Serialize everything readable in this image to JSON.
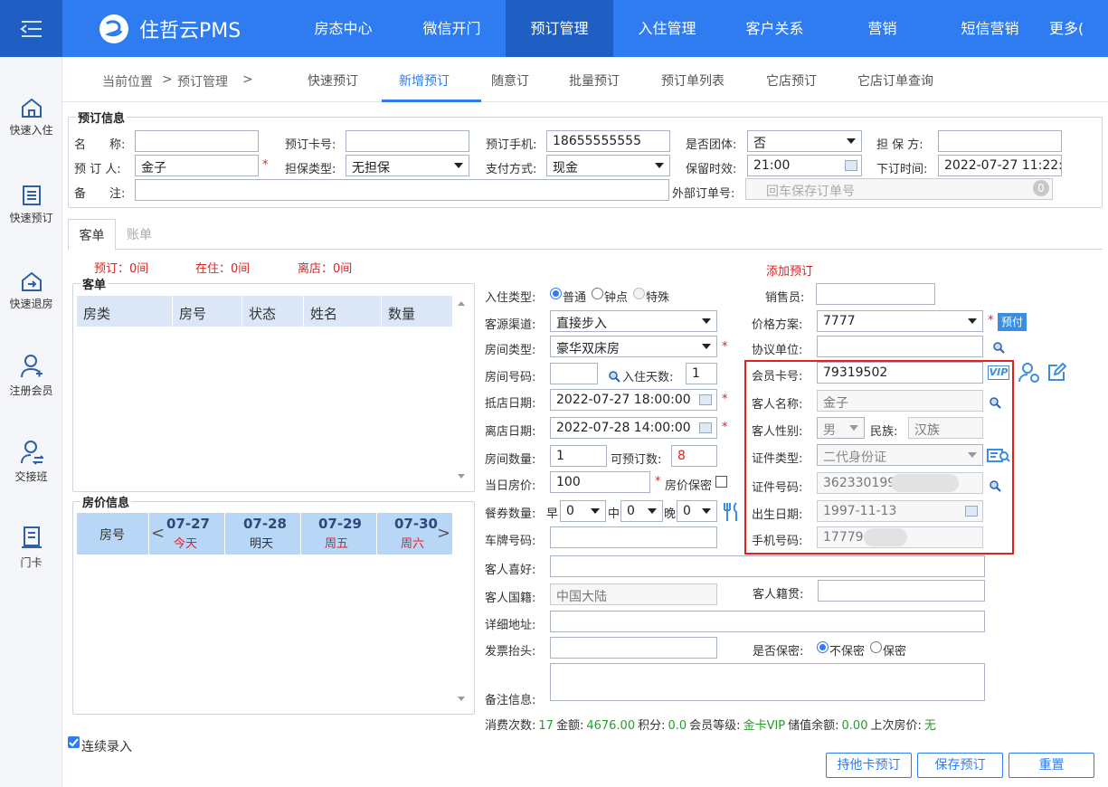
{
  "app": {
    "name": "住哲云PMS"
  },
  "nav": [
    "房态中心",
    "微信开门",
    "预订管理",
    "入住管理",
    "客户关系",
    "营销",
    "短信营销",
    "更多("
  ],
  "sidebar": [
    "快速入住",
    "快速预订",
    "快速退房",
    "注册会员",
    "交接班",
    "门卡"
  ],
  "breadcrumb": {
    "label": "当前位置",
    "sep1": ">",
    "page": "预订管理",
    "sep2": ">"
  },
  "subtabs": [
    "快速预订",
    "新增预订",
    "随意订",
    "批量预订",
    "预订单列表",
    "它店预订",
    "它店订单查询"
  ],
  "booking": {
    "legend": "预订信息",
    "name_label": "名　　称:",
    "name_value": "",
    "booker_label": "预 订 人:",
    "booker_value": "金子",
    "remark_label": "备　　注:",
    "remark_value": "",
    "card_label": "预订卡号:",
    "card_value": "",
    "guarantee_type_label": "担保类型:",
    "guarantee_type_value": "无担保",
    "phone_label": "预订手机:",
    "phone_value": "18655555555",
    "pay_label": "支付方式:",
    "pay_value": "现金",
    "group_label": "是否团体:",
    "group_value": "否",
    "hold_label": "保留时效:",
    "hold_value": "21:00",
    "guarantor_label": "担 保 方:",
    "guarantor_value": "",
    "order_time_label": "下订时间:",
    "order_time_value": "2022-07-27 11:22:5",
    "ext_order_label": "外部订单号:",
    "ext_order_placeholder": "回车保存订单号",
    "ext_badge": "0"
  },
  "tabs": {
    "guest": "客单",
    "bill": "账单"
  },
  "stats": {
    "reserved": "预订：0间",
    "in": "在住：0间",
    "out": "离店：0间"
  },
  "add_link": "添加预订",
  "guest_list": {
    "legend": "客单",
    "cols": [
      "房类",
      "房号",
      "状态",
      "姓名",
      "数量"
    ]
  },
  "price": {
    "legend": "房价信息",
    "room_no": "房号",
    "days": [
      {
        "date": "07-27",
        "sub": "今天"
      },
      {
        "date": "07-28",
        "sub": "明天"
      },
      {
        "date": "07-29",
        "sub": "周五"
      },
      {
        "date": "07-30",
        "sub": "周六"
      }
    ]
  },
  "form": {
    "checkin_type_label": "入住类型:",
    "checkin_types": [
      "普通",
      "钟点",
      "特殊"
    ],
    "source_label": "客源渠道:",
    "source_value": "直接步入",
    "room_type_label": "房间类型:",
    "room_type_value": "豪华双床房",
    "room_no_label": "房间号码:",
    "room_no_value": "",
    "days_label": "入住天数:",
    "days_value": "1",
    "arrive_label": "抵店日期:",
    "arrive_value": "2022-07-27 18:00:00",
    "leave_label": "离店日期:",
    "leave_value": "2022-07-28 14:00:00",
    "rooms_label": "房间数量:",
    "rooms_value": "1",
    "avail_label": "可预订数:",
    "avail_value": "8",
    "price_label": "当日房价:",
    "price_value": "100",
    "secret_price": "房价保密",
    "meal_label": "餐券数量:",
    "breakfast": "早",
    "lunch": "中",
    "dinner": "晚",
    "meal_b": "0",
    "meal_l": "0",
    "meal_d": "0",
    "plate_label": "车牌号码:",
    "plate_value": "",
    "hobby_label": "客人喜好:",
    "hobby_value": "",
    "nation_label": "客人国籍:",
    "nation_value": "中国大陆",
    "native_label": "客人籍贯:",
    "native_value": "",
    "addr_label": "详细地址:",
    "addr_value": "",
    "invoice_label": "发票抬头:",
    "invoice_value": "",
    "secret_label": "是否保密:",
    "secret_opts": [
      "不保密",
      "保密"
    ],
    "note_label": "备注信息:",
    "note_value": "",
    "sales_label": "销售员:",
    "sales_value": "",
    "plan_label": "价格方案:",
    "plan_value": "7777",
    "prepay": "预付",
    "agreement_label": "协议单位:",
    "agreement_value": "",
    "member_label": "会员卡号:",
    "member_value": "79319502",
    "vip": "VIP",
    "guest_name_label": "客人名称:",
    "guest_name_value": "金子",
    "gender_label": "客人性别:",
    "gender_value": "男",
    "ethnic_label": "民族:",
    "ethnic_value": "汉族",
    "id_type_label": "证件类型:",
    "id_type_value": "二代身份证",
    "id_no_label": "证件号码:",
    "id_no_value": "362330199",
    "birth_label": "出生日期:",
    "birth_value": "1997-11-13",
    "mobile_label": "手机号码:",
    "mobile_value": "17779"
  },
  "summary": {
    "visits_label": "消费次数:",
    "visits": "17",
    "amount_label": "金额:",
    "amount": "4676.00",
    "points_label": "积分:",
    "points": "0.0",
    "level_label": "会员等级:",
    "level": "金卡VIP",
    "balance_label": "储值余额:",
    "balance": "0.00",
    "last_label": "上次房价:",
    "last": "无"
  },
  "continuous": "连续录入",
  "buttons": {
    "other": "持他卡预订",
    "save": "保存预订",
    "reset": "重置"
  }
}
